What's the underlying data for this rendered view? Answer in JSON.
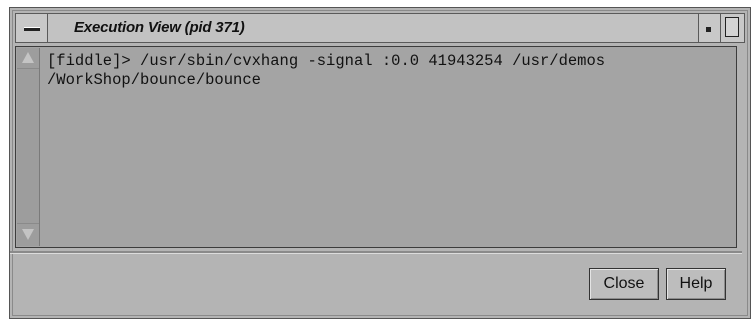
{
  "window": {
    "title": "Execution View (pid 371)"
  },
  "console": {
    "lines": [
      "[fiddle]> /usr/sbin/cvxhang -signal :0.0 41943254 /usr/demos",
      "/WorkShop/bounce/bounce"
    ]
  },
  "buttons": {
    "close_label": "Close",
    "help_label": "Help"
  },
  "colors": {
    "window_bg": "#b4b4b4",
    "text_area_bg": "#a4a4a4",
    "title_bar_bg": "#c2c2c2"
  },
  "icons": {
    "window_menu": "window-menu-icon",
    "minimize": "minimize-icon",
    "maximize": "maximize-icon",
    "scroll_up": "scroll-up-arrow-icon",
    "scroll_down": "scroll-down-arrow-icon"
  }
}
